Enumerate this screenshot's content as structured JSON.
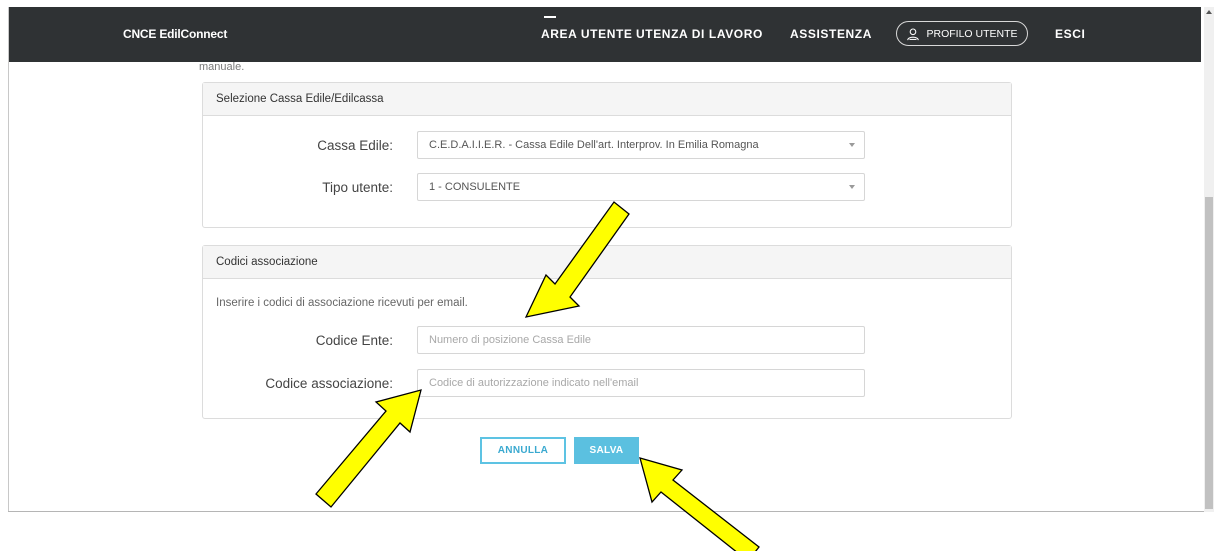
{
  "navbar": {
    "brand": "CNCE EdilConnect",
    "links": {
      "area_utente": "AREA UTENTE",
      "utenza_lavoro": "UTENZA DI LAVORO",
      "assistenza": "ASSISTENZA",
      "profilo": "PROFILO UTENTE",
      "esci": "ESCI"
    },
    "profile_icon": "user-icon",
    "active": "AREA UTENTE"
  },
  "cut_text": "manuale.",
  "cassa_panel": {
    "title": "Selezione Cassa Edile/Edilcassa",
    "cassa_label": "Cassa Edile:",
    "cassa_value": "C.E.D.A.I.I.E.R. - Cassa Edile Dell'art. Interprov. In Emilia Romagna",
    "tipo_label": "Tipo utente:",
    "tipo_value": "1 - CONSULENTE"
  },
  "codici_panel": {
    "title": "Codici associazione",
    "hint": "Inserire i codici di associazione ricevuti per email.",
    "ente_label": "Codice Ente:",
    "ente_placeholder": "Numero di posizione Cassa Edile",
    "assoc_label": "Codice associazione:",
    "assoc_placeholder": "Codice di autorizzazione indicato nell'email"
  },
  "actions": {
    "cancel": "ANNULLA",
    "save": "SALVA"
  },
  "annotations": {
    "arrow_color": "#ffff00",
    "arrow_outline": "#000000",
    "icon": "arrow-annotation-icon"
  },
  "colors": {
    "navbar_bg": "#2f3234",
    "accent": "#5bc0e0"
  }
}
